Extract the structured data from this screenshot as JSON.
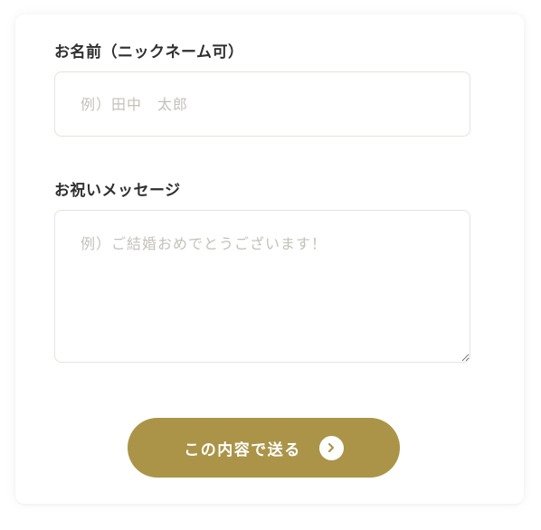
{
  "form": {
    "name": {
      "label": "お名前（ニックネーム可）",
      "placeholder": "例）田中　太郎",
      "value": ""
    },
    "message": {
      "label": "お祝いメッセージ",
      "placeholder": "例）ご結婚おめでとうございます！",
      "value": ""
    },
    "submit": {
      "label": "この内容で送る",
      "icon": "chevron-right-circle-icon"
    }
  },
  "colors": {
    "accent": "#ab9448",
    "label_text": "#2f2f2f",
    "placeholder": "#c4c1ba",
    "field_border": "#e6e3dc"
  }
}
